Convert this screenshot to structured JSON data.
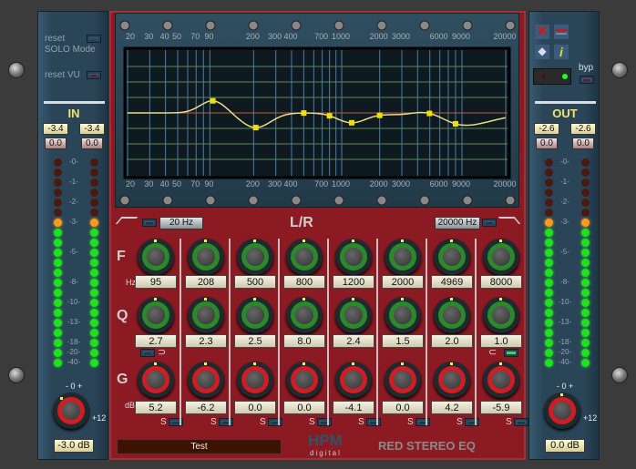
{
  "left": {
    "reset_label": "reset",
    "solo_label": "SOLO Mode",
    "reset_vu_label": "reset VU",
    "title": "IN",
    "peak": [
      "-3.4",
      "-3.4"
    ],
    "clip": [
      "0.0",
      "0.0"
    ],
    "knob_scale": "- 0 +",
    "knob_max": "+12",
    "gain_value": "-3.0 dB"
  },
  "right": {
    "bypass_label": "byp",
    "title": "OUT",
    "peak": [
      "-2.6",
      "-2.6"
    ],
    "clip": [
      "0.0",
      "0.0"
    ],
    "knob_scale": "- 0 +",
    "knob_max": "+12",
    "gain_value": "0.0 dB",
    "icons": [
      "close-icon",
      "minimize-icon",
      "preset-icon",
      "info-icon"
    ]
  },
  "meter": {
    "labels": [
      "-0-",
      "-1-",
      "-2-",
      "-3-",
      "-5-",
      "-8-",
      "-10-",
      "-13-",
      "-18-",
      "-20-",
      "-40-"
    ],
    "colors": {
      "off": "#4a1a10",
      "orange": "#ff9a1a",
      "green": "#20e020"
    }
  },
  "graph": {
    "freq_labels": [
      "20",
      "30",
      "40",
      "50",
      "70",
      "90",
      "200",
      "300",
      "400",
      "700",
      "1000",
      "2000",
      "3000",
      "6000",
      "9000",
      "20000"
    ],
    "curve_color": "#e8dc88",
    "point_color": "#f0e000"
  },
  "eq": {
    "low_cut": "20 Hz",
    "high_cut": "20000 Hz",
    "channel": "L/R",
    "row_f": "F",
    "row_q": "Q",
    "row_g": "G",
    "unit_hz": "Hz",
    "unit_db": "dB",
    "solo": "S",
    "bands": [
      {
        "freq": "95",
        "q": "2.7",
        "gain": "5.2"
      },
      {
        "freq": "208",
        "q": "2.3",
        "gain": "-6.2"
      },
      {
        "freq": "500",
        "q": "2.5",
        "gain": "0.0"
      },
      {
        "freq": "800",
        "q": "8.0",
        "gain": "0.0"
      },
      {
        "freq": "1200",
        "q": "2.4",
        "gain": "-4.1"
      },
      {
        "freq": "2000",
        "q": "1.5",
        "gain": "0.0"
      },
      {
        "freq": "4969",
        "q": "2.0",
        "gain": "4.2"
      },
      {
        "freq": "8000",
        "q": "1.0",
        "gain": "-5.9"
      }
    ]
  },
  "footer": {
    "preset_name": "Test",
    "brand": "HPM",
    "brand_sub": "digital",
    "product": "RED STEREO EQ"
  }
}
